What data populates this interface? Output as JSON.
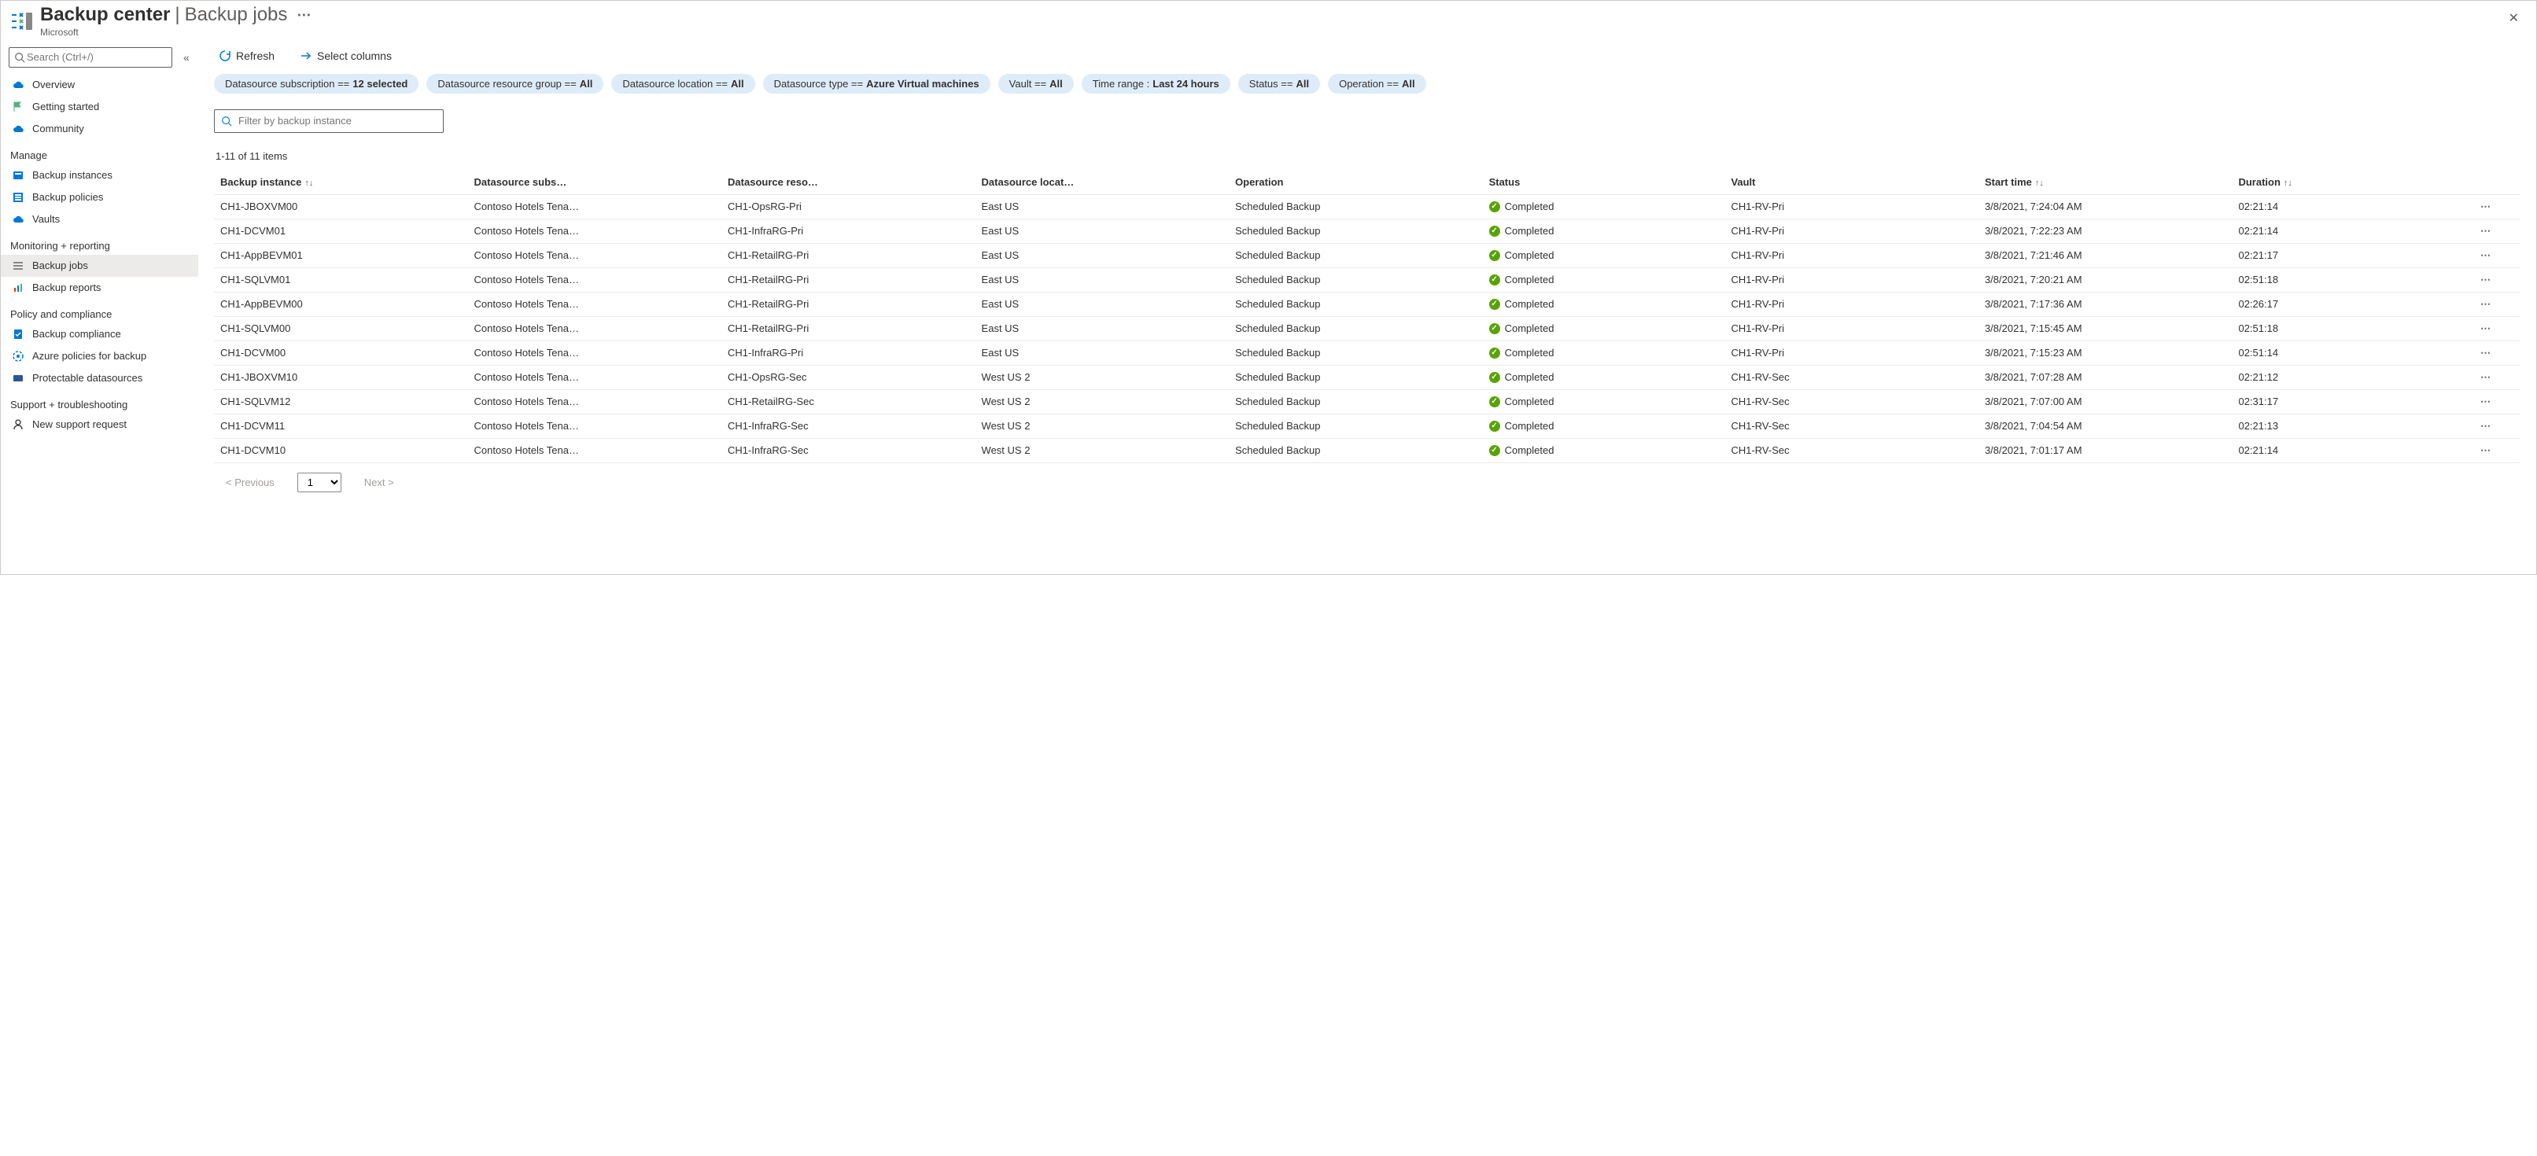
{
  "header": {
    "title_main": "Backup center",
    "title_sep": "|",
    "title_sub": "Backup jobs",
    "subtitle": "Microsoft"
  },
  "sidebar": {
    "search_placeholder": "Search (Ctrl+/)",
    "groups": [
      {
        "items": [
          {
            "label": "Overview",
            "icon": "cloud"
          },
          {
            "label": "Getting started",
            "icon": "flag"
          },
          {
            "label": "Community",
            "icon": "cloud2"
          }
        ]
      },
      {
        "heading": "Manage",
        "items": [
          {
            "label": "Backup instances",
            "icon": "instances"
          },
          {
            "label": "Backup policies",
            "icon": "policies"
          },
          {
            "label": "Vaults",
            "icon": "vaults"
          }
        ]
      },
      {
        "heading": "Monitoring + reporting",
        "items": [
          {
            "label": "Backup jobs",
            "icon": "jobs",
            "selected": true
          },
          {
            "label": "Backup reports",
            "icon": "reports"
          }
        ]
      },
      {
        "heading": "Policy and compliance",
        "items": [
          {
            "label": "Backup compliance",
            "icon": "compliance"
          },
          {
            "label": "Azure policies for backup",
            "icon": "azpolicy"
          },
          {
            "label": "Protectable datasources",
            "icon": "protectable"
          }
        ]
      },
      {
        "heading": "Support + troubleshooting",
        "items": [
          {
            "label": "New support request",
            "icon": "support"
          }
        ]
      }
    ]
  },
  "toolbar": {
    "refresh": "Refresh",
    "select_columns": "Select columns"
  },
  "filters": [
    {
      "label": "Datasource subscription == ",
      "value": "12 selected"
    },
    {
      "label": "Datasource resource group == ",
      "value": "All"
    },
    {
      "label": "Datasource location == ",
      "value": "All"
    },
    {
      "label": "Datasource type == ",
      "value": "Azure Virtual machines"
    },
    {
      "label": "Vault == ",
      "value": "All"
    },
    {
      "label": "Time range : ",
      "value": "Last 24 hours"
    },
    {
      "label": "Status == ",
      "value": "All"
    },
    {
      "label": "Operation == ",
      "value": "All"
    }
  ],
  "instance_filter_placeholder": "Filter by backup instance",
  "count_text": "1-11 of 11 items",
  "columns": [
    "Backup instance",
    "Datasource subs…",
    "Datasource reso…",
    "Datasource locat…",
    "Operation",
    "Status",
    "Vault",
    "Start time",
    "Duration"
  ],
  "sort_controls": {
    "backup_instance": true,
    "start_time": true,
    "duration": true
  },
  "rows": [
    {
      "instance": "CH1-JBOXVM00",
      "subs": "Contoso Hotels Tena…",
      "rg": "CH1-OpsRG-Pri",
      "loc": "East US",
      "op": "Scheduled Backup",
      "status": "Completed",
      "vault": "CH1-RV-Pri",
      "start": "3/8/2021, 7:24:04 AM",
      "dur": "02:21:14"
    },
    {
      "instance": "CH1-DCVM01",
      "subs": "Contoso Hotels Tena…",
      "rg": "CH1-InfraRG-Pri",
      "loc": "East US",
      "op": "Scheduled Backup",
      "status": "Completed",
      "vault": "CH1-RV-Pri",
      "start": "3/8/2021, 7:22:23 AM",
      "dur": "02:21:14"
    },
    {
      "instance": "CH1-AppBEVM01",
      "subs": "Contoso Hotels Tena…",
      "rg": "CH1-RetailRG-Pri",
      "loc": "East US",
      "op": "Scheduled Backup",
      "status": "Completed",
      "vault": "CH1-RV-Pri",
      "start": "3/8/2021, 7:21:46 AM",
      "dur": "02:21:17"
    },
    {
      "instance": "CH1-SQLVM01",
      "subs": "Contoso Hotels Tena…",
      "rg": "CH1-RetailRG-Pri",
      "loc": "East US",
      "op": "Scheduled Backup",
      "status": "Completed",
      "vault": "CH1-RV-Pri",
      "start": "3/8/2021, 7:20:21 AM",
      "dur": "02:51:18"
    },
    {
      "instance": "CH1-AppBEVM00",
      "subs": "Contoso Hotels Tena…",
      "rg": "CH1-RetailRG-Pri",
      "loc": "East US",
      "op": "Scheduled Backup",
      "status": "Completed",
      "vault": "CH1-RV-Pri",
      "start": "3/8/2021, 7:17:36 AM",
      "dur": "02:26:17"
    },
    {
      "instance": "CH1-SQLVM00",
      "subs": "Contoso Hotels Tena…",
      "rg": "CH1-RetailRG-Pri",
      "loc": "East US",
      "op": "Scheduled Backup",
      "status": "Completed",
      "vault": "CH1-RV-Pri",
      "start": "3/8/2021, 7:15:45 AM",
      "dur": "02:51:18"
    },
    {
      "instance": "CH1-DCVM00",
      "subs": "Contoso Hotels Tena…",
      "rg": "CH1-InfraRG-Pri",
      "loc": "East US",
      "op": "Scheduled Backup",
      "status": "Completed",
      "vault": "CH1-RV-Pri",
      "start": "3/8/2021, 7:15:23 AM",
      "dur": "02:51:14"
    },
    {
      "instance": "CH1-JBOXVM10",
      "subs": "Contoso Hotels Tena…",
      "rg": "CH1-OpsRG-Sec",
      "loc": "West US 2",
      "op": "Scheduled Backup",
      "status": "Completed",
      "vault": "CH1-RV-Sec",
      "start": "3/8/2021, 7:07:28 AM",
      "dur": "02:21:12"
    },
    {
      "instance": "CH1-SQLVM12",
      "subs": "Contoso Hotels Tena…",
      "rg": "CH1-RetailRG-Sec",
      "loc": "West US 2",
      "op": "Scheduled Backup",
      "status": "Completed",
      "vault": "CH1-RV-Sec",
      "start": "3/8/2021, 7:07:00 AM",
      "dur": "02:31:17"
    },
    {
      "instance": "CH1-DCVM11",
      "subs": "Contoso Hotels Tena…",
      "rg": "CH1-InfraRG-Sec",
      "loc": "West US 2",
      "op": "Scheduled Backup",
      "status": "Completed",
      "vault": "CH1-RV-Sec",
      "start": "3/8/2021, 7:04:54 AM",
      "dur": "02:21:13"
    },
    {
      "instance": "CH1-DCVM10",
      "subs": "Contoso Hotels Tena…",
      "rg": "CH1-InfraRG-Sec",
      "loc": "West US 2",
      "op": "Scheduled Backup",
      "status": "Completed",
      "vault": "CH1-RV-Sec",
      "start": "3/8/2021, 7:01:17 AM",
      "dur": "02:21:14"
    }
  ],
  "pager": {
    "prev": "< Previous",
    "next": "Next >",
    "page": "1"
  }
}
